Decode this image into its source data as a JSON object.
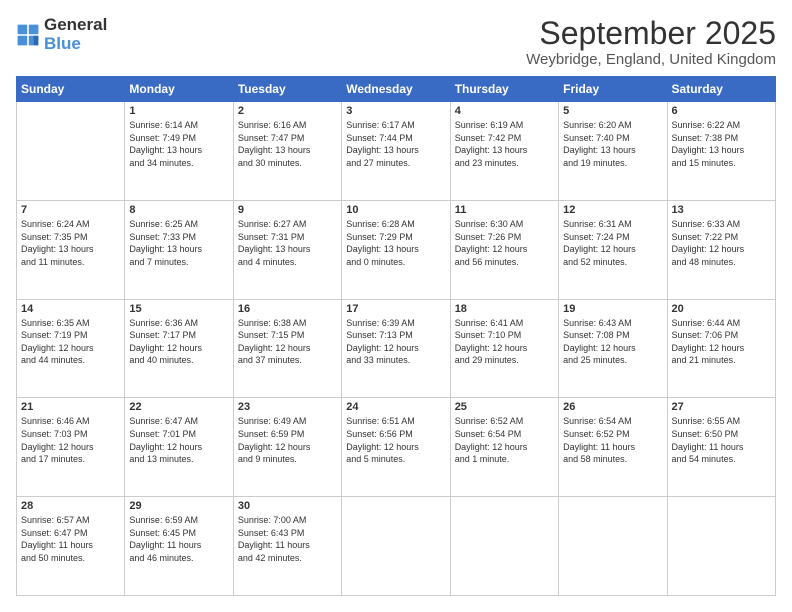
{
  "logo": {
    "line1": "General",
    "line2": "Blue"
  },
  "title": "September 2025",
  "location": "Weybridge, England, United Kingdom",
  "days_header": [
    "Sunday",
    "Monday",
    "Tuesday",
    "Wednesday",
    "Thursday",
    "Friday",
    "Saturday"
  ],
  "weeks": [
    [
      {
        "day": "",
        "info": ""
      },
      {
        "day": "1",
        "info": "Sunrise: 6:14 AM\nSunset: 7:49 PM\nDaylight: 13 hours\nand 34 minutes."
      },
      {
        "day": "2",
        "info": "Sunrise: 6:16 AM\nSunset: 7:47 PM\nDaylight: 13 hours\nand 30 minutes."
      },
      {
        "day": "3",
        "info": "Sunrise: 6:17 AM\nSunset: 7:44 PM\nDaylight: 13 hours\nand 27 minutes."
      },
      {
        "day": "4",
        "info": "Sunrise: 6:19 AM\nSunset: 7:42 PM\nDaylight: 13 hours\nand 23 minutes."
      },
      {
        "day": "5",
        "info": "Sunrise: 6:20 AM\nSunset: 7:40 PM\nDaylight: 13 hours\nand 19 minutes."
      },
      {
        "day": "6",
        "info": "Sunrise: 6:22 AM\nSunset: 7:38 PM\nDaylight: 13 hours\nand 15 minutes."
      }
    ],
    [
      {
        "day": "7",
        "info": "Sunrise: 6:24 AM\nSunset: 7:35 PM\nDaylight: 13 hours\nand 11 minutes."
      },
      {
        "day": "8",
        "info": "Sunrise: 6:25 AM\nSunset: 7:33 PM\nDaylight: 13 hours\nand 7 minutes."
      },
      {
        "day": "9",
        "info": "Sunrise: 6:27 AM\nSunset: 7:31 PM\nDaylight: 13 hours\nand 4 minutes."
      },
      {
        "day": "10",
        "info": "Sunrise: 6:28 AM\nSunset: 7:29 PM\nDaylight: 13 hours\nand 0 minutes."
      },
      {
        "day": "11",
        "info": "Sunrise: 6:30 AM\nSunset: 7:26 PM\nDaylight: 12 hours\nand 56 minutes."
      },
      {
        "day": "12",
        "info": "Sunrise: 6:31 AM\nSunset: 7:24 PM\nDaylight: 12 hours\nand 52 minutes."
      },
      {
        "day": "13",
        "info": "Sunrise: 6:33 AM\nSunset: 7:22 PM\nDaylight: 12 hours\nand 48 minutes."
      }
    ],
    [
      {
        "day": "14",
        "info": "Sunrise: 6:35 AM\nSunset: 7:19 PM\nDaylight: 12 hours\nand 44 minutes."
      },
      {
        "day": "15",
        "info": "Sunrise: 6:36 AM\nSunset: 7:17 PM\nDaylight: 12 hours\nand 40 minutes."
      },
      {
        "day": "16",
        "info": "Sunrise: 6:38 AM\nSunset: 7:15 PM\nDaylight: 12 hours\nand 37 minutes."
      },
      {
        "day": "17",
        "info": "Sunrise: 6:39 AM\nSunset: 7:13 PM\nDaylight: 12 hours\nand 33 minutes."
      },
      {
        "day": "18",
        "info": "Sunrise: 6:41 AM\nSunset: 7:10 PM\nDaylight: 12 hours\nand 29 minutes."
      },
      {
        "day": "19",
        "info": "Sunrise: 6:43 AM\nSunset: 7:08 PM\nDaylight: 12 hours\nand 25 minutes."
      },
      {
        "day": "20",
        "info": "Sunrise: 6:44 AM\nSunset: 7:06 PM\nDaylight: 12 hours\nand 21 minutes."
      }
    ],
    [
      {
        "day": "21",
        "info": "Sunrise: 6:46 AM\nSunset: 7:03 PM\nDaylight: 12 hours\nand 17 minutes."
      },
      {
        "day": "22",
        "info": "Sunrise: 6:47 AM\nSunset: 7:01 PM\nDaylight: 12 hours\nand 13 minutes."
      },
      {
        "day": "23",
        "info": "Sunrise: 6:49 AM\nSunset: 6:59 PM\nDaylight: 12 hours\nand 9 minutes."
      },
      {
        "day": "24",
        "info": "Sunrise: 6:51 AM\nSunset: 6:56 PM\nDaylight: 12 hours\nand 5 minutes."
      },
      {
        "day": "25",
        "info": "Sunrise: 6:52 AM\nSunset: 6:54 PM\nDaylight: 12 hours\nand 1 minute."
      },
      {
        "day": "26",
        "info": "Sunrise: 6:54 AM\nSunset: 6:52 PM\nDaylight: 11 hours\nand 58 minutes."
      },
      {
        "day": "27",
        "info": "Sunrise: 6:55 AM\nSunset: 6:50 PM\nDaylight: 11 hours\nand 54 minutes."
      }
    ],
    [
      {
        "day": "28",
        "info": "Sunrise: 6:57 AM\nSunset: 6:47 PM\nDaylight: 11 hours\nand 50 minutes."
      },
      {
        "day": "29",
        "info": "Sunrise: 6:59 AM\nSunset: 6:45 PM\nDaylight: 11 hours\nand 46 minutes."
      },
      {
        "day": "30",
        "info": "Sunrise: 7:00 AM\nSunset: 6:43 PM\nDaylight: 11 hours\nand 42 minutes."
      },
      {
        "day": "",
        "info": ""
      },
      {
        "day": "",
        "info": ""
      },
      {
        "day": "",
        "info": ""
      },
      {
        "day": "",
        "info": ""
      }
    ]
  ]
}
